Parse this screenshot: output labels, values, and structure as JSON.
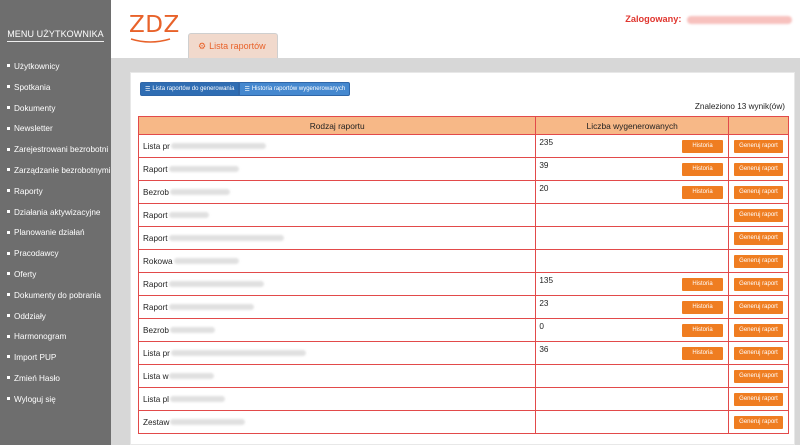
{
  "sidebar": {
    "title": "MENU UŻYTKOWNIKA",
    "items": [
      {
        "label": "Użytkownicy"
      },
      {
        "label": "Spotkania"
      },
      {
        "label": "Dokumenty"
      },
      {
        "label": "Newsletter"
      },
      {
        "label": "Zarejestrowani bezrobotni"
      },
      {
        "label": "Zarządzanie bezrobotnymi"
      },
      {
        "label": "Raporty"
      },
      {
        "label": "Działania aktywizacyjne"
      },
      {
        "label": "Planowanie działań"
      },
      {
        "label": "Pracodawcy"
      },
      {
        "label": "Oferty"
      },
      {
        "label": "Dokumenty do pobrania"
      },
      {
        "label": "Oddziały"
      },
      {
        "label": "Harmonogram"
      },
      {
        "label": "Import PUP"
      },
      {
        "label": "Zmień Hasło"
      },
      {
        "label": "Wyloguj się"
      }
    ]
  },
  "header": {
    "logo": "ZDZ",
    "tab_label": "Lista raportów",
    "logged_label": "Zalogowany:"
  },
  "toolbar": {
    "btn_to_generate": "Lista raportów do generowania",
    "btn_history": "Historia raportów wygenerowanych"
  },
  "found_text": "Znaleziono 13 wynik(ów)",
  "table": {
    "headers": [
      "Rodzaj raportu",
      "Liczba wygenerowanych",
      ""
    ],
    "history_label": "Historia",
    "generate_label": "Generuj raport",
    "rows": [
      {
        "name": "Lista pr",
        "count": "235",
        "has_history": true
      },
      {
        "name": "Raport",
        "count": "39",
        "has_history": true
      },
      {
        "name": "Bezrob",
        "count": "20",
        "has_history": true
      },
      {
        "name": "Raport",
        "count": "",
        "has_history": false
      },
      {
        "name": "Raport",
        "count": "",
        "has_history": false
      },
      {
        "name": "Rokowa",
        "count": "",
        "has_history": false
      },
      {
        "name": "Raport",
        "count": "135",
        "has_history": true
      },
      {
        "name": "Raport",
        "count": "23",
        "has_history": true
      },
      {
        "name": "Bezrob",
        "count": "0",
        "has_history": true
      },
      {
        "name": "Lista pr",
        "count": "36",
        "has_history": true
      },
      {
        "name": "Lista w",
        "count": "",
        "has_history": false
      },
      {
        "name": "Lista pl",
        "count": "",
        "has_history": false
      },
      {
        "name": "Zestaw",
        "count": "",
        "has_history": false
      }
    ]
  },
  "colors": {
    "sidebar_bg": "#6e6e6e",
    "accent_orange": "#ef7d21",
    "table_border": "#e24a4a",
    "table_header": "#f7b887",
    "button_blue": "#3d79c1",
    "logged_red": "#e0362f"
  }
}
